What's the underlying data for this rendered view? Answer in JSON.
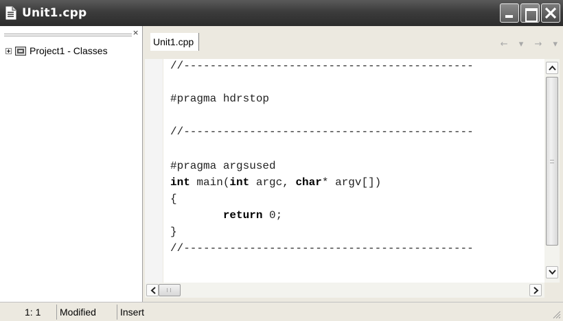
{
  "window": {
    "title": "Unit1.cpp"
  },
  "explorer": {
    "close_glyph": "×",
    "items": [
      {
        "label": "Project1 - Classes"
      }
    ]
  },
  "editor": {
    "tabs": [
      {
        "label": "Unit1.cpp"
      }
    ],
    "nav_arrows": "← ▾ → ▾",
    "code_lines": [
      "//--------------------------------------------",
      "",
      "#pragma hdrstop",
      "",
      "//--------------------------------------------",
      "",
      "#pragma argsused",
      "int main(int argc, char* argv[])",
      "{",
      "        return 0;",
      "}",
      "//--------------------------------------------"
    ]
  },
  "statusbar": {
    "position": "1:  1",
    "modified": "Modified",
    "mode": "Insert"
  }
}
